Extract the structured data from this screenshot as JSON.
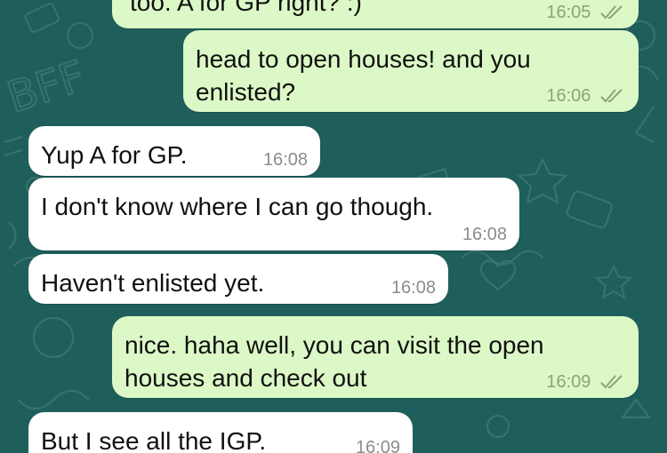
{
  "colors": {
    "wallpaper": "#1f5f5b",
    "incoming_bubble": "#ffffff",
    "outgoing_bubble": "#dcf8c6",
    "timestamp_in": "#8c8c8c",
    "timestamp_out": "#8aa57a"
  },
  "messages": [
    {
      "direction": "out",
      "text": "too. A for GP right? :)",
      "time": "16:05",
      "status_icon": "double-check-icon"
    },
    {
      "direction": "out",
      "text": "head to open houses! and you enlisted?",
      "time": "16:06",
      "status_icon": "double-check-icon"
    },
    {
      "direction": "in",
      "text": "Yup A for GP.",
      "time": "16:08"
    },
    {
      "direction": "in",
      "text": "I don't know where I can go though.",
      "time": "16:08"
    },
    {
      "direction": "in",
      "text": "Haven't enlisted yet.",
      "time": "16:08"
    },
    {
      "direction": "out",
      "text": "nice. haha well, you can visit the open houses and check out",
      "time": "16:09",
      "status_icon": "double-check-icon"
    },
    {
      "direction": "in",
      "text": "But I see all the IGP.",
      "time": "16:09"
    }
  ]
}
